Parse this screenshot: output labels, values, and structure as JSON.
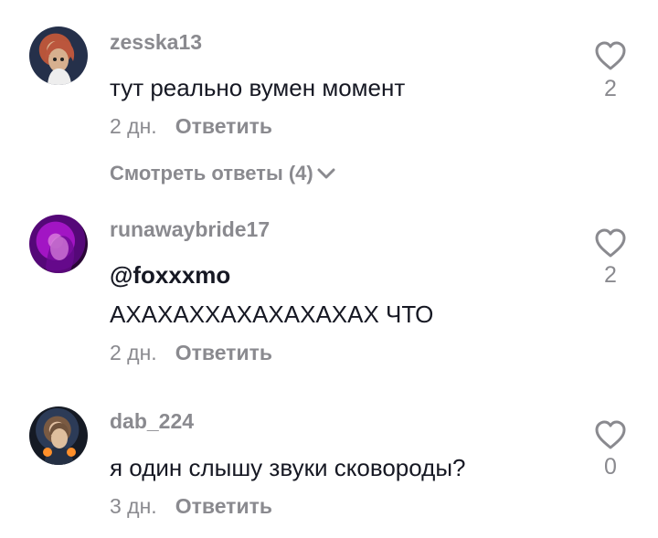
{
  "comments": [
    {
      "username": "zesska13",
      "text": "тут реально вумен момент",
      "time": "2 дн.",
      "reply_label": "Ответить",
      "likes": "2",
      "view_replies": "Смотреть ответы (4)"
    },
    {
      "username": "runawaybride17",
      "mention": "@foxxxmo",
      "text": "АХАХАХХАХАХАХАХАХ ЧТО",
      "time": "2 дн.",
      "reply_label": "Ответить",
      "likes": "2"
    },
    {
      "username": "dab_224",
      "text": "я один слышу звуки сковороды?",
      "time": "3 дн.",
      "reply_label": "Ответить",
      "likes": "0"
    }
  ],
  "icons": {
    "like": "heart-outline-icon",
    "expand": "chevron-down-icon"
  },
  "colors": {
    "primary_text": "#161823",
    "secondary_text": "#8a8a8f",
    "background": "#ffffff"
  }
}
